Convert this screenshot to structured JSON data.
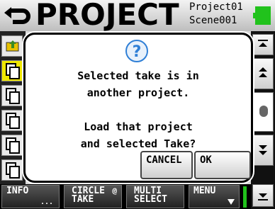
{
  "header": {
    "title": "PROJECT",
    "project_name": "Project01",
    "scene_name": "Scene001"
  },
  "dialog": {
    "line1": "Selected take is in",
    "line2": "another project.",
    "line3": "Load that project",
    "line4": "and selected Take?",
    "cancel_label": "CANCEL",
    "ok_label": "OK"
  },
  "function_bar": {
    "info_label": "INFO",
    "info_sub": "...",
    "circle_take_line1": "CIRCLE",
    "circle_take_line2": "TAKE",
    "circle_take_symbol": "@",
    "multi_select_line1": "MULTI",
    "multi_select_line2": "SELECT",
    "menu_label": "MENU"
  },
  "icons": {
    "back": "back-arrow-icon",
    "battery": "battery-icon",
    "question": "question-icon",
    "folder_up": "folder-up-icon",
    "take_file": "take-file-icon",
    "scroll_top": "scroll-top-icon",
    "scroll_up": "scroll-up-icon",
    "scroll_down": "scroll-down-icon",
    "scroll_bottom": "scroll-bottom-icon",
    "menu_dropdown": "menu-dropdown-icon"
  },
  "colors": {
    "selected_item": "#f0e800",
    "battery": "#21c21c",
    "question_icon": "#2f7fd6"
  }
}
